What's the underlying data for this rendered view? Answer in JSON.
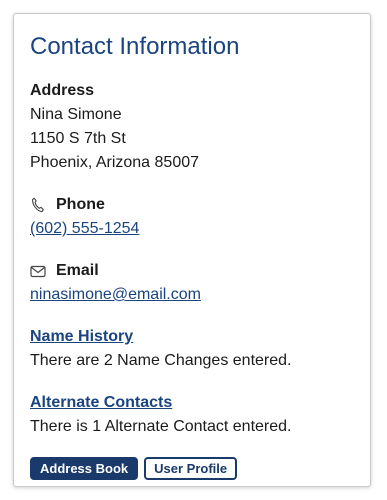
{
  "card": {
    "title": "Contact Information"
  },
  "address": {
    "heading": "Address",
    "name": "Nina Simone",
    "street": "1150 S 7th St",
    "city_state_zip": "Phoenix, Arizona 85007"
  },
  "phone": {
    "heading": "Phone",
    "icon": "phone-icon",
    "value": "(602) 555-1254"
  },
  "email": {
    "heading": "Email",
    "icon": "envelope-icon",
    "value": "ninasimone@email.com"
  },
  "name_history": {
    "link_label": "Name History",
    "summary": "There are 2 Name Changes entered."
  },
  "alternate_contacts": {
    "link_label": "Alternate Contacts",
    "summary": "There is 1 Alternate Contact entered."
  },
  "buttons": {
    "address_book": "Address Book",
    "user_profile": "User Profile"
  },
  "colors": {
    "title": "#1a4480",
    "link": "#1a4480",
    "button_primary": "#1a3a6b"
  }
}
